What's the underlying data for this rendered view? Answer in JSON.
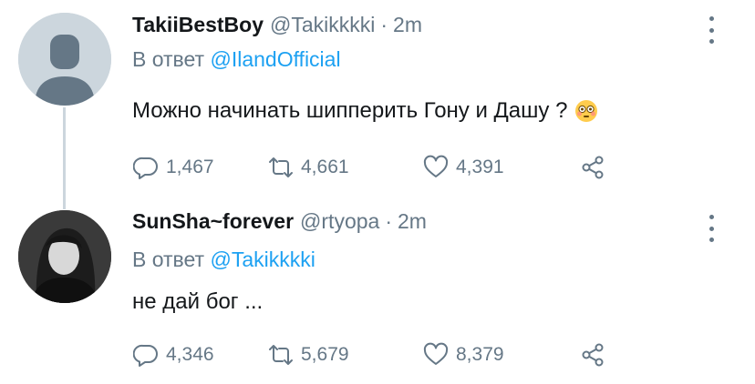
{
  "tweets": [
    {
      "name": "TakiiBestBoy",
      "handle": "@Takikkkki",
      "separator": "·",
      "time": "2m",
      "reply_prefix": "В ответ",
      "reply_mention": "@IlandOfficial",
      "text": "Можно начинать шипперить Гону и Дашу ?",
      "text_emoji": "flushed-face-icon",
      "replies": "1,467",
      "retweets": "4,661",
      "likes": "4,391"
    },
    {
      "name": "SunSha~forever",
      "handle": "@rtyopa",
      "separator": "·",
      "time": "2m",
      "reply_prefix": "В ответ",
      "reply_mention": "@Takikkkki",
      "text": "не дай бог ...",
      "replies": "4,346",
      "retweets": "5,679",
      "likes": "8,379"
    }
  ],
  "colors": {
    "text": "#14171a",
    "muted": "#657786",
    "link": "#1da1f2",
    "thread_line": "#ccd6dd"
  }
}
